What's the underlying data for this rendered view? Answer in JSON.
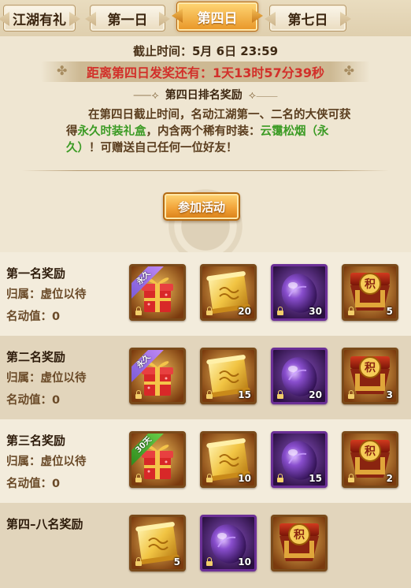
{
  "tabs": [
    {
      "label": "江湖有礼",
      "active": false
    },
    {
      "label": "第一日",
      "active": false
    },
    {
      "label": "第四日",
      "active": true
    },
    {
      "label": "第七日",
      "active": false
    }
  ],
  "header": {
    "deadline_label": "截止时间：",
    "deadline_value": "5月 6日 23:59",
    "countdown": "距离第四日发奖还有：1天13时57分39秒",
    "rank_title": "第四日排名奖励",
    "desc_1": "在第四日截止时间，名动江湖第一、二名的大侠可获得",
    "desc_green_1": "永久时装礼盒",
    "desc_2": "，内含两个稀有时装：",
    "desc_green_2": "云霭松烟（永久）",
    "desc_3": "！可赠送自己任何一位好友！",
    "join_button": "参加活动"
  },
  "colors": {
    "accent": "#e89526",
    "countdown": "#d2302a",
    "highlight": "#3b9b24",
    "background": "#efe6d2"
  },
  "rewards": [
    {
      "title": "第一名奖励",
      "owner_label": "归属：",
      "owner_value": "虚位以待",
      "score_label": "名动值：",
      "score_value": "0",
      "items": [
        {
          "icon": "gift-box-icon",
          "badge": "永久",
          "count": ""
        },
        {
          "icon": "scroll-icon",
          "badge": "",
          "count": "20"
        },
        {
          "icon": "purple-stone-icon",
          "badge": "",
          "count": "30"
        },
        {
          "icon": "points-chest-icon",
          "badge": "",
          "count": "5"
        }
      ]
    },
    {
      "title": "第二名奖励",
      "owner_label": "归属：",
      "owner_value": "虚位以待",
      "score_label": "名动值：",
      "score_value": "0",
      "items": [
        {
          "icon": "gift-box-icon",
          "badge": "永久",
          "count": ""
        },
        {
          "icon": "scroll-icon",
          "badge": "",
          "count": "15"
        },
        {
          "icon": "purple-stone-icon",
          "badge": "",
          "count": "20"
        },
        {
          "icon": "points-chest-icon",
          "badge": "",
          "count": "3"
        }
      ]
    },
    {
      "title": "第三名奖励",
      "owner_label": "归属：",
      "owner_value": "虚位以待",
      "score_label": "名动值：",
      "score_value": "0",
      "items": [
        {
          "icon": "gift-box-icon",
          "badge": "30天",
          "count": ""
        },
        {
          "icon": "scroll-icon",
          "badge": "",
          "count": "10"
        },
        {
          "icon": "purple-stone-icon",
          "badge": "",
          "count": "15"
        },
        {
          "icon": "points-chest-icon",
          "badge": "",
          "count": "2"
        }
      ]
    },
    {
      "title": "第四–八名奖励",
      "items": [
        {
          "icon": "scroll-icon",
          "badge": "",
          "count": "5"
        },
        {
          "icon": "purple-stone-icon",
          "badge": "",
          "count": "10"
        },
        {
          "icon": "points-chest-icon",
          "badge": "",
          "count": ""
        }
      ]
    }
  ]
}
